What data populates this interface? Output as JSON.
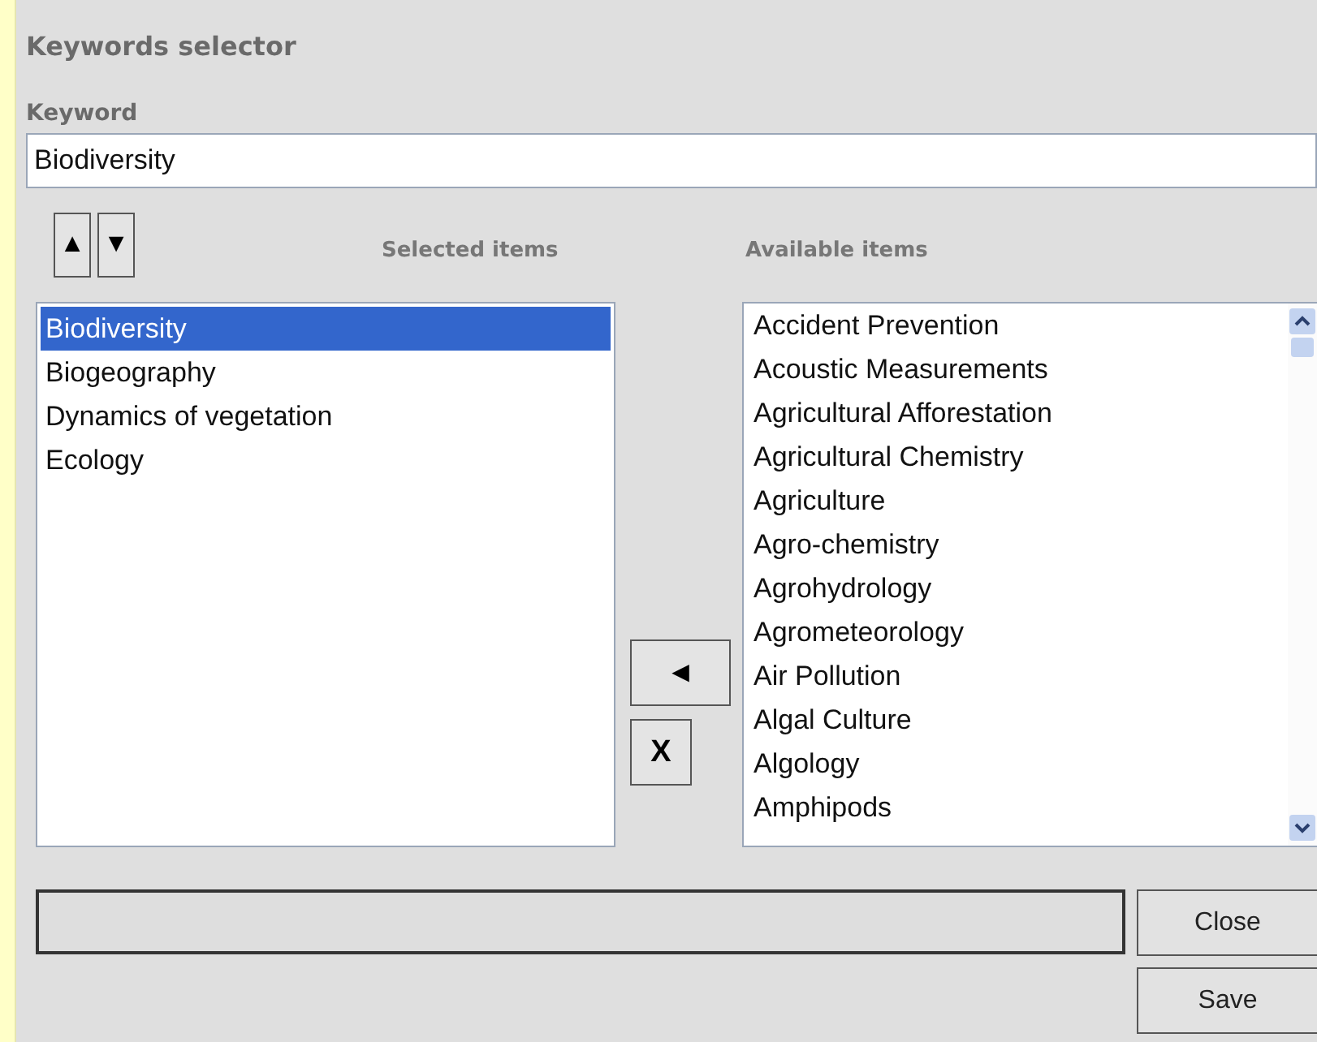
{
  "title": "Keywords selector",
  "keyword": {
    "label": "Keyword",
    "value": "Biodiversity"
  },
  "order_buttons": [
    "▲",
    "▼"
  ],
  "selected_list": {
    "heading": "Selected items",
    "items": [
      {
        "label": "Biodiversity",
        "selected": true
      },
      {
        "label": "Biogeography",
        "selected": false
      },
      {
        "label": "Dynamics of vegetation",
        "selected": false
      },
      {
        "label": "Ecology",
        "selected": false
      }
    ]
  },
  "transfer_buttons": [
    "◄",
    "X"
  ],
  "available_list": {
    "heading": "Available items",
    "items": [
      {
        "label": "Accident Prevention",
        "selected": false
      },
      {
        "label": "Acoustic Measurements",
        "selected": false
      },
      {
        "label": "Agricultural Afforestation",
        "selected": false
      },
      {
        "label": "Agricultural Chemistry",
        "selected": false
      },
      {
        "label": "Agriculture",
        "selected": false
      },
      {
        "label": "Agro-chemistry",
        "selected": false
      },
      {
        "label": "Agrohydrology",
        "selected": false
      },
      {
        "label": "Agrometeorology",
        "selected": false
      },
      {
        "label": "Air Pollution",
        "selected": false
      },
      {
        "label": "Algal Culture",
        "selected": false
      },
      {
        "label": "Algology",
        "selected": false
      },
      {
        "label": "Amphipods",
        "selected": false
      }
    ]
  },
  "buttons": [
    "Close",
    "Save"
  ]
}
